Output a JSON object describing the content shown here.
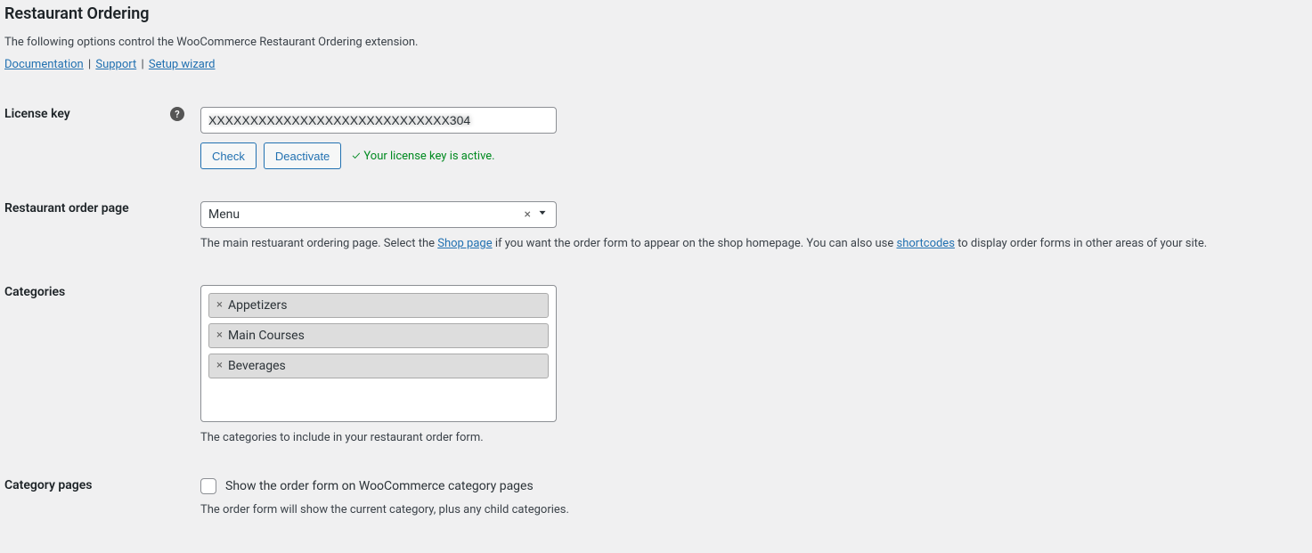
{
  "page_title": "Restaurant Ordering",
  "intro_text": "The following options control the WooCommerce Restaurant Ordering extension.",
  "links": {
    "documentation": "Documentation",
    "support": "Support",
    "setup_wizard": "Setup wizard"
  },
  "license": {
    "label": "License key",
    "value": "XXXXXXXXXXXXXXXXXXXXXXXXXXXXX304",
    "check_button": "Check",
    "deactivate_button": "Deactivate",
    "status_text": "Your license key is active."
  },
  "order_page": {
    "label": "Restaurant order page",
    "selected": "Menu",
    "desc_prefix": "The main restuarant ordering page. Select the ",
    "desc_link1": "Shop page",
    "desc_mid": " if you want the order form to appear on the shop homepage. You can also use ",
    "desc_link2": "shortcodes",
    "desc_suffix": " to display order forms in other areas of your site."
  },
  "categories": {
    "label": "Categories",
    "items": [
      "Appetizers",
      "Main Courses",
      "Beverages"
    ],
    "description": "The categories to include in your restaurant order form."
  },
  "category_pages": {
    "label": "Category pages",
    "checkbox_label": "Show the order form on WooCommerce category pages",
    "description": "The order form will show the current category, plus any child categories."
  }
}
